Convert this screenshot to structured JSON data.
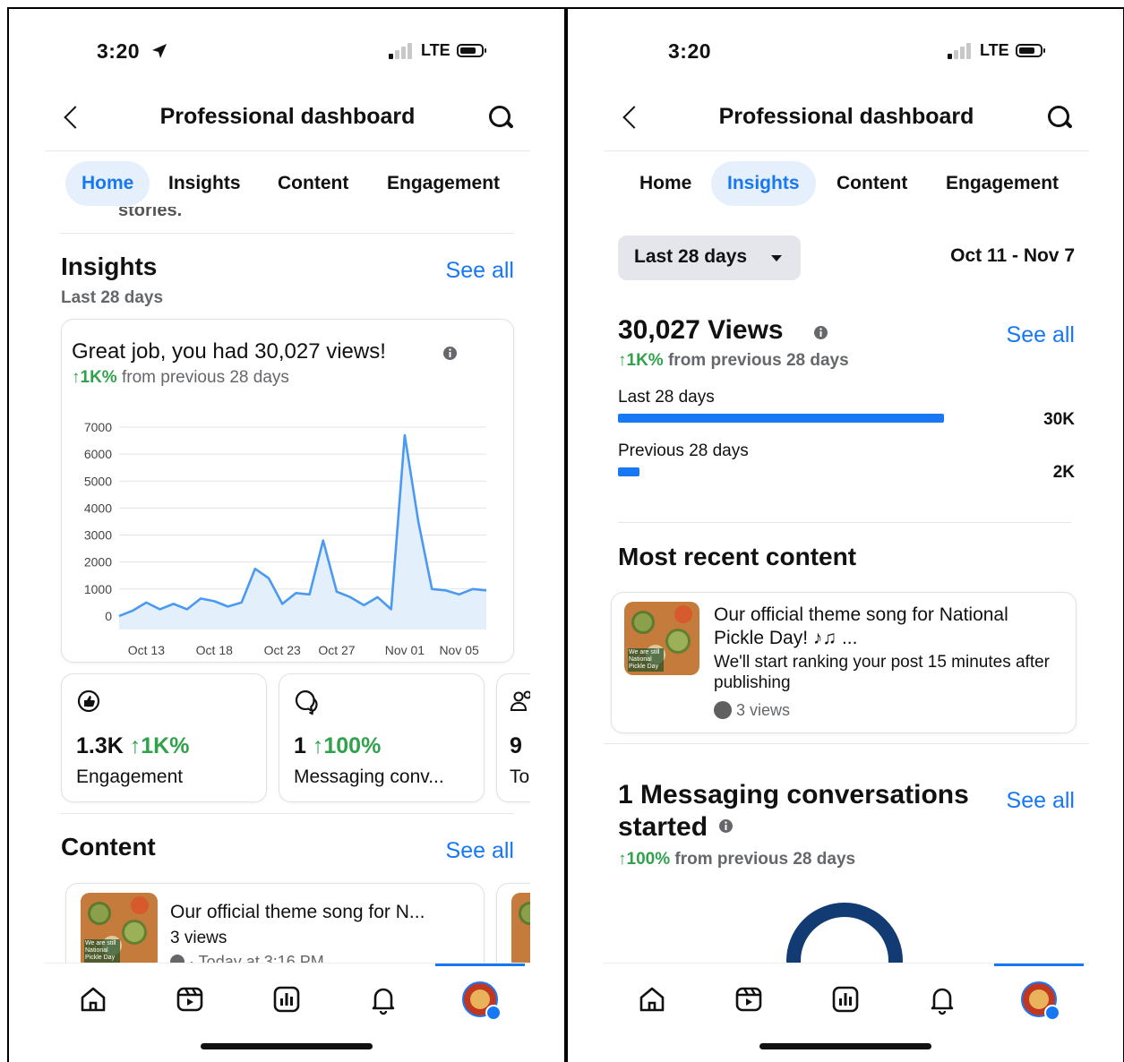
{
  "colors": {
    "accent": "#1877f2",
    "positive": "#31a24c",
    "tab_active_bg": "#e6f0fc",
    "donut": "#123a73"
  },
  "left": {
    "status": {
      "time": "3:20",
      "network": "LTE"
    },
    "header": {
      "title": "Professional dashboard"
    },
    "tabs": [
      {
        "label": "Home",
        "active": true
      },
      {
        "label": "Insights",
        "active": false
      },
      {
        "label": "Content",
        "active": false
      },
      {
        "label": "Engagement",
        "active": false
      }
    ],
    "cutoff_text": "stories.",
    "insights": {
      "title": "Insights",
      "see_all": "See all",
      "period": "Last 28 days",
      "card_headline": "Great job, you had 30,027 views!",
      "change": "↑1K%",
      "change_suffix": "from previous 28 days"
    },
    "metrics": [
      {
        "icon": "like-icon",
        "value": "1.3K",
        "change": "↑1K%",
        "label": "Engagement"
      },
      {
        "icon": "messenger-icon",
        "value": "1",
        "change": "↑100%",
        "label": "Messaging conv..."
      },
      {
        "icon": "people-icon",
        "value": "9",
        "change": "",
        "label": "To"
      }
    ],
    "content": {
      "title": "Content",
      "see_all": "See all",
      "item": {
        "title": "Our official theme song for N...",
        "views": "3 views",
        "time": "· Today at 3:16 PM"
      }
    }
  },
  "right": {
    "status": {
      "time": "3:20",
      "network": "LTE"
    },
    "header": {
      "title": "Professional dashboard"
    },
    "tabs": [
      {
        "label": "Home",
        "active": false
      },
      {
        "label": "Insights",
        "active": true
      },
      {
        "label": "Content",
        "active": false
      },
      {
        "label": "Engagement",
        "active": false
      }
    ],
    "range_select": "Last 28 days",
    "date_range": "Oct 11 - Nov 7",
    "views": {
      "title": "30,027 Views",
      "see_all": "See all",
      "change": "↑1K%",
      "change_suffix": "from previous 28 days",
      "bars": [
        {
          "label": "Last 28 days",
          "value": 30027,
          "display": "30K"
        },
        {
          "label": "Previous 28 days",
          "value": 2000,
          "display": "2K"
        }
      ]
    },
    "recent": {
      "title": "Most recent content",
      "item_title": "Our official theme song for National Pickle Day! ♪♫ ...",
      "item_note": "We'll start ranking your post 15 minutes after publishing",
      "item_views": "3 views"
    },
    "messaging": {
      "title": "1 Messaging conversations started",
      "see_all": "See all",
      "change": "↑100%",
      "change_suffix": "from previous 28 days"
    }
  },
  "chart_data": {
    "type": "area",
    "x_tick_labels": [
      "Oct 13",
      "Oct 18",
      "Oct 23",
      "Oct 27",
      "Nov 01",
      "Nov 05"
    ],
    "y_tick_labels": [
      "0",
      "1000",
      "2000",
      "3000",
      "4000",
      "5000",
      "6000",
      "7000"
    ],
    "ylim": [
      -500,
      7000
    ],
    "x": [
      "Oct 11",
      "Oct 12",
      "Oct 13",
      "Oct 14",
      "Oct 15",
      "Oct 16",
      "Oct 17",
      "Oct 18",
      "Oct 19",
      "Oct 20",
      "Oct 21",
      "Oct 22",
      "Oct 23",
      "Oct 24",
      "Oct 25",
      "Oct 26",
      "Oct 27",
      "Oct 28",
      "Oct 29",
      "Oct 30",
      "Oct 31",
      "Nov 01",
      "Nov 02",
      "Nov 03",
      "Nov 04",
      "Nov 05",
      "Nov 06",
      "Nov 07"
    ],
    "series": [
      {
        "values": [
          0,
          200,
          500,
          250,
          450,
          250,
          650,
          550,
          350,
          500,
          1750,
          1400,
          450,
          850,
          800,
          2800,
          900,
          700,
          400,
          700,
          250,
          6700,
          3500,
          1000,
          950,
          800,
          1000,
          950
        ]
      }
    ],
    "grid": true,
    "color": "#4a99f2"
  }
}
